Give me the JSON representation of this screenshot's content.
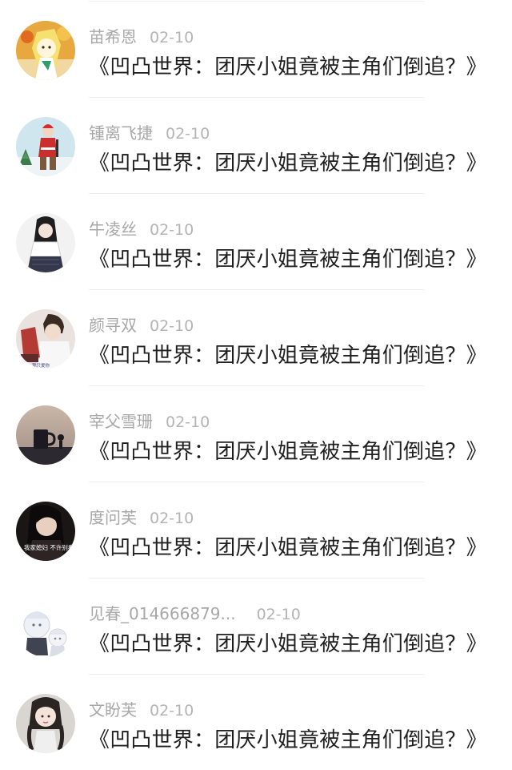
{
  "comments": [
    {
      "user": "苗希恩",
      "date": "02-10",
      "text": "《凹凸世界：团厌小姐竟被主角们倒追？》",
      "avatar_icon": "avatar-anime-yellow-icon"
    },
    {
      "user": "锺离飞捷",
      "date": "02-10",
      "text": "《凹凸世界：团厌小姐竟被主角们倒追？》",
      "avatar_icon": "avatar-game-character-icon"
    },
    {
      "user": "牛凌丝",
      "date": "02-10",
      "text": "《凹凸世界：团厌小姐竟被主角们倒追？》",
      "avatar_icon": "avatar-girl-portrait-icon"
    },
    {
      "user": "颜寻双",
      "date": "02-10",
      "text": "《凹凸世界：团厌小姐竟被主角们倒追？》",
      "avatar_icon": "avatar-boy-portrait-icon"
    },
    {
      "user": "宰父雪珊",
      "date": "02-10",
      "text": "《凹凸世界：团厌小姐竟被主角们倒追？》",
      "avatar_icon": "avatar-mug-scene-icon"
    },
    {
      "user": "度问芙",
      "date": "02-10",
      "text": "《凹凸世界：团厌小姐竟被主角们倒追？》",
      "avatar_icon": "avatar-woman-caption-icon"
    },
    {
      "user": "见春_014666879...",
      "date": "02-10",
      "text": "《凹凸世界：团厌小姐竟被主角们倒追？》",
      "avatar_icon": "avatar-cartoon-kids-icon"
    },
    {
      "user": "文盼芙",
      "date": "02-10",
      "text": "《凹凸世界：团厌小姐竟被主角们倒追？》",
      "avatar_icon": "avatar-girl-braids-icon"
    }
  ],
  "avatar_captions": {
    "row4": "我只爱你",
    "row6": "我家媳妇 不许别看"
  },
  "colors": {
    "username": "#a8a8a8",
    "date": "#b4b4b4",
    "text": "#1f1f1f",
    "divider": "#ececec",
    "background": "#ffffff"
  }
}
